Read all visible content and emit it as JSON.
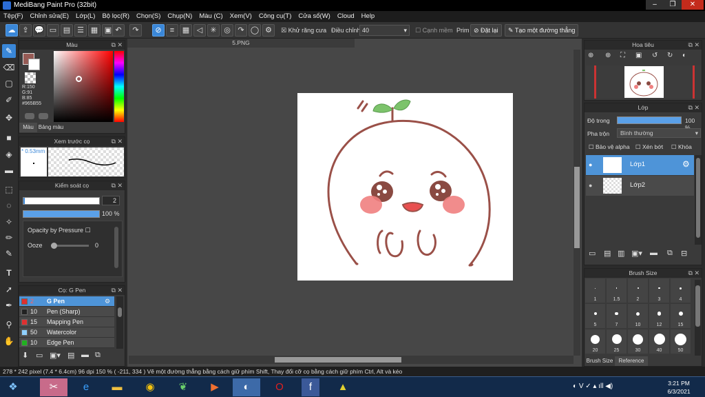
{
  "window": {
    "title": "MediBang Paint Pro (32bit)"
  },
  "menu": [
    "Tệp(F)",
    "Chỉnh sửa(E)",
    "Lớp(L)",
    "Bộ lọc(R)",
    "Chọn(S)",
    "Chụp(N)",
    "Màu (C)",
    "Xem(V)",
    "Công cụ(T)",
    "Cửa sổ(W)",
    "Cloud",
    "Help"
  ],
  "toolbar": {
    "antialias": "Khử răng cưa",
    "adjust_label": "Điều chỉnh",
    "adjust_value": "40",
    "edge": "Cạnh mềm",
    "prim": "Prim",
    "reset": "Đặt lại",
    "create_line": "Tạo một đường thẳng"
  },
  "color_panel": {
    "title": "Màu",
    "r": "R:150",
    "g": "G:91",
    "b": "B:85",
    "hex": "#965B55",
    "tab_color": "Màu",
    "tab_palette": "Bảng màu",
    "accent": "#965B55"
  },
  "brush_preview": {
    "title": "Xem trước cọ",
    "size": "0.53mm"
  },
  "brush_control": {
    "title": "Kiểm soát cọ",
    "size_value": "2",
    "opacity_value": "100 %",
    "opacity_pressure": "Opacity by Pressure",
    "ooze_label": "Ooze",
    "ooze_value": "0"
  },
  "brush_list": {
    "title": "Cọ: G Pen",
    "items": [
      {
        "size": "2",
        "name": "G Pen",
        "color": "#e03030",
        "selected": true
      },
      {
        "size": "10",
        "name": "Pen (Sharp)",
        "color": "#222222",
        "selected": false
      },
      {
        "size": "15",
        "name": "Mapping Pen",
        "color": "#e03030",
        "selected": false
      },
      {
        "size": "50",
        "name": "Watercolor",
        "color": "#8fd0ff",
        "selected": false
      },
      {
        "size": "10",
        "name": "Edge Pen",
        "color": "#20b020",
        "selected": false
      }
    ]
  },
  "document": {
    "tab": "5.PNG"
  },
  "navigator": {
    "title": "Hoa tiêu"
  },
  "layer_panel": {
    "title": "Lớp",
    "opacity_label": "Độ trong",
    "opacity_value": "100 %",
    "blend_label": "Pha trộn",
    "blend_value": "Bình thường",
    "protect_alpha": "Bảo vệ alpha",
    "clipping": "Xén bớt",
    "lock": "Khóa",
    "layers": [
      {
        "name": "Lớp1",
        "selected": true
      },
      {
        "name": "Lớp2",
        "selected": false
      }
    ]
  },
  "brush_size_panel": {
    "title": "Brush Size",
    "sizes": [
      "1",
      "1.5",
      "2",
      "3",
      "4",
      "5",
      "7",
      "10",
      "12",
      "15",
      "20",
      "25",
      "30",
      "40",
      "50"
    ],
    "tab_brush": "Brush Size",
    "tab_ref": "Reference"
  },
  "status": {
    "text": "278 * 242 pixel   (7.4 * 6.4cm)   96 dpi   150 %   ( -211, 334 )   Vẽ một đường thẳng bằng cách giữ phím Shift, Thay đổi cỡ cọ bằng cách giữ phím Ctrl, Alt và kéo"
  },
  "taskbar": {
    "time": "3:21 PM",
    "date": "6/3/2021"
  }
}
